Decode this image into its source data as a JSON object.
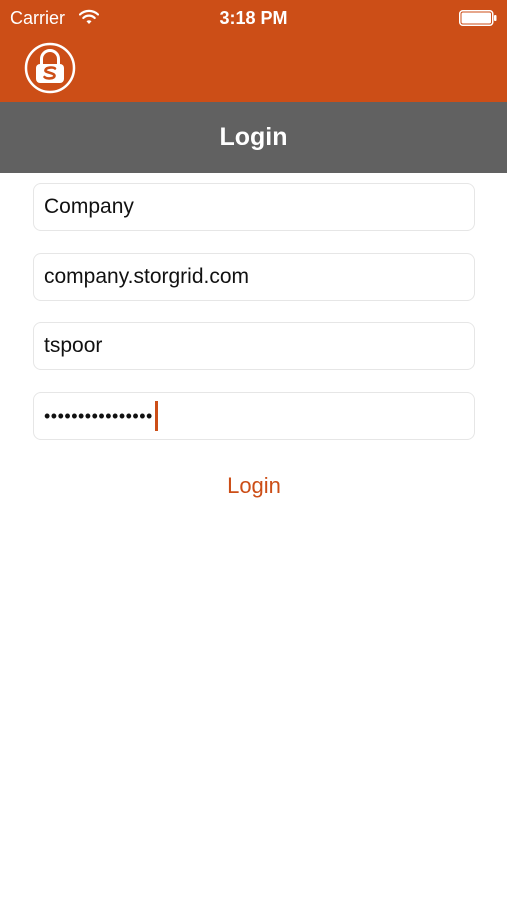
{
  "status_bar": {
    "carrier": "Carrier",
    "time": "3:18 PM",
    "icons": [
      "wifi-icon",
      "battery-icon"
    ]
  },
  "header": {
    "logo_icon": "lock-s-icon",
    "title": "Login"
  },
  "form": {
    "company": {
      "value": "Company"
    },
    "server": {
      "value": "company.storgrid.com"
    },
    "username": {
      "value": "tspoor"
    },
    "password": {
      "masked_value": "••••••••••••••••"
    }
  },
  "login_label": "Login",
  "colors": {
    "brand": "#cc4e17",
    "title_bar": "#616161",
    "background": "#ffffff",
    "field_border": "#e6e6e6"
  }
}
